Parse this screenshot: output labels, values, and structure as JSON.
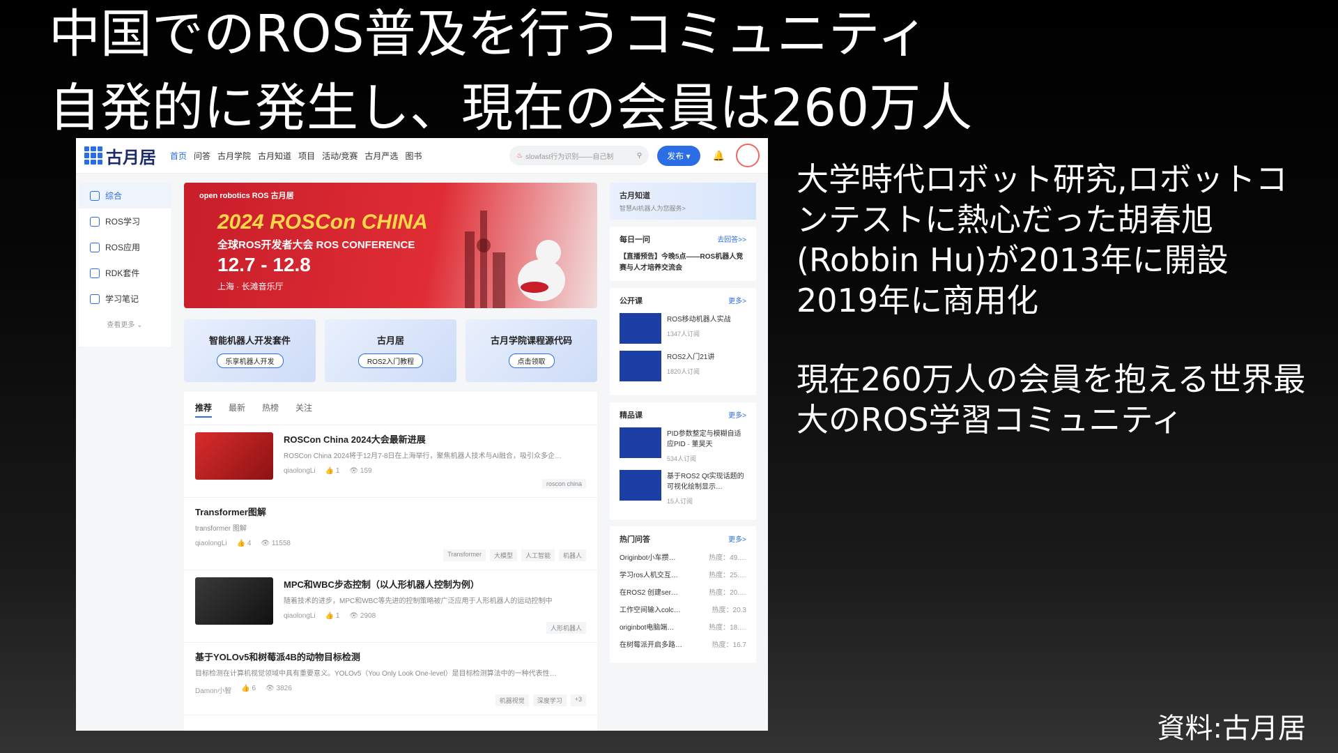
{
  "slide": {
    "title_line1": "中国でのROS普及を行うコミュニティ",
    "title_line2": "自発的に発生し、現在の会員は260万人",
    "body": [
      "大学時代ロボット研究,ロボットコンテストに熱心だった胡春旭(Robbin Hu)が2013年に開設",
      "2019年に商用化",
      "現在260万人の会員を抱える世界最大のROS学習コミュニティ"
    ],
    "source": "資料:古月居"
  },
  "screenshot": {
    "logo": "古月居",
    "nav": [
      "首页",
      "问答",
      "古月学院",
      "古月知道",
      "项目",
      "活动/竞赛",
      "古月严选",
      "图书"
    ],
    "search_placeholder": "slowfast行为识别——自己制",
    "publish": "发布",
    "sidebar": [
      "综合",
      "ROS学习",
      "ROS应用",
      "RDK套件",
      "学习笔记"
    ],
    "sidebar_more": "查看更多",
    "banner": {
      "brands": "open robotics  ROS  古月居",
      "year_title": "2024 ROSCon CHINA",
      "subtitle": "全球ROS开发者大会 ROS CONFERENCE",
      "dates": "12.7 - 12.8",
      "location": "上海 · 长滩音乐厅"
    },
    "cards": [
      {
        "title": "智能机器人开发套件",
        "button": "乐享机器人开发"
      },
      {
        "title": "古月居",
        "button": "ROS2入门教程"
      },
      {
        "title": "古月学院课程源代码",
        "button": "点击领取"
      }
    ],
    "feed_tabs": [
      "推荐",
      "最新",
      "热榜",
      "关注"
    ],
    "posts": [
      {
        "title": "ROSCon China 2024大会最新进展",
        "desc": "ROSCon China 2024将于12月7-8日在上海举行，聚焦机器人技术与AI融合，吸引众多企…",
        "author": "qiaolongLi",
        "likes": "1",
        "views": "159",
        "tags": [
          "roscon china"
        ]
      },
      {
        "title": "Transformer图解",
        "desc": "transformer 图解",
        "author": "qiaolongLi",
        "likes": "4",
        "views": "11558",
        "tags": [
          "Transformer",
          "大模型",
          "人工智能",
          "机器人"
        ]
      },
      {
        "title": "MPC和WBC步态控制（以人形机器人控制为例）",
        "desc": "随着技术的进步，MPC和WBC等先进的控制策略被广泛应用于人形机器人的运动控制中",
        "author": "qiaolongLi",
        "likes": "1",
        "views": "2908",
        "tags": [
          "人形机器人"
        ]
      },
      {
        "title": "基于YOLOv5和树莓派4B的动物目标检测",
        "desc": "目标检测在计算机视觉领域中具有重要意义。YOLOv5（You Only Look One-level）是目标检测算法中的一种代表性…",
        "author": "Damon小智",
        "likes": "6",
        "views": "3826",
        "tags": [
          "机器视觉",
          "深度学习",
          "+3"
        ]
      }
    ],
    "right": {
      "zhidao_title": "古月知道",
      "zhidao_sub": "智慧AI机器人为您服务>",
      "daily_title": "每日一问",
      "daily_link": "去回答>>",
      "daily_text": "【直播预告】今晚5点——ROS机器人竞赛与人才培养交流会",
      "open_title": "公开课",
      "more": "更多>",
      "open_courses": [
        {
          "name": "ROS移动机器人实战",
          "count": "1347人订阅"
        },
        {
          "name": "ROS2入门21讲",
          "count": "1820人订阅"
        }
      ],
      "quality_title": "精品课",
      "quality_courses": [
        {
          "name": "PID参数整定与模糊自适应PID · 董昊天",
          "count": "534人订阅"
        },
        {
          "name": "基于ROS2 Qt实现话题的可视化绘制显示…",
          "count": "15人订阅"
        }
      ],
      "hot_title": "热门问答",
      "hot": [
        {
          "q": "Originbot小车攒…",
          "heat": "热度：49.…"
        },
        {
          "q": "学习ros人机交互…",
          "heat": "热度：25.…"
        },
        {
          "q": "在ROS2 创建ser…",
          "heat": "热度：20.…"
        },
        {
          "q": "工作空间输入colc…",
          "heat": "热度：20.3"
        },
        {
          "q": "originbot电脑端…",
          "heat": "热度：18.…"
        },
        {
          "q": "在树莓派开启多路…",
          "heat": "热度：16.7"
        }
      ]
    }
  }
}
